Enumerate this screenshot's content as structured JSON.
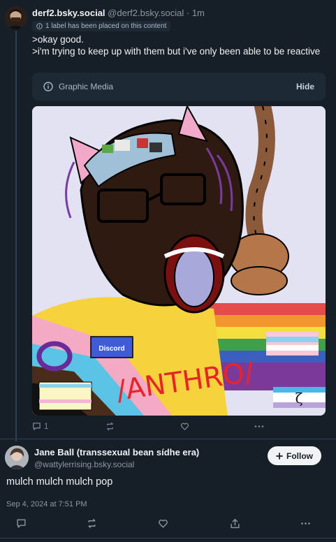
{
  "post1": {
    "display_name": "derf2.bsky.social",
    "handle": "@derf2.bsky.social",
    "separator": "·",
    "time": "1m",
    "label_notice": "1 label has been placed on this content",
    "text_lines": [
      ">okay good.",
      ">i'm trying to keep up with them but i've only been able to be reactive"
    ],
    "content_warning": {
      "label": "Graphic Media",
      "hide_button": "Hide"
    },
    "image": {
      "icon": "wojak-drawing",
      "discord_label": "Discord",
      "scrawl_text": "/ANTHRO/",
      "symbol": "ζ"
    },
    "actions": {
      "reply_count": "1"
    }
  },
  "post2": {
    "display_name": "Jane Ball (transsexual bean sídhe era)",
    "handle": "@wattylerrising.bsky.social",
    "follow_button": "Follow",
    "text": "mulch mulch mulch pop",
    "timestamp": "Sep 4, 2024 at 7:51 PM"
  },
  "colors": {
    "background": "#161e27",
    "text_primary": "#f1f3f5",
    "text_secondary": "#8b98a5",
    "surface": "#1e2936",
    "thread_line": "#2e4052"
  }
}
